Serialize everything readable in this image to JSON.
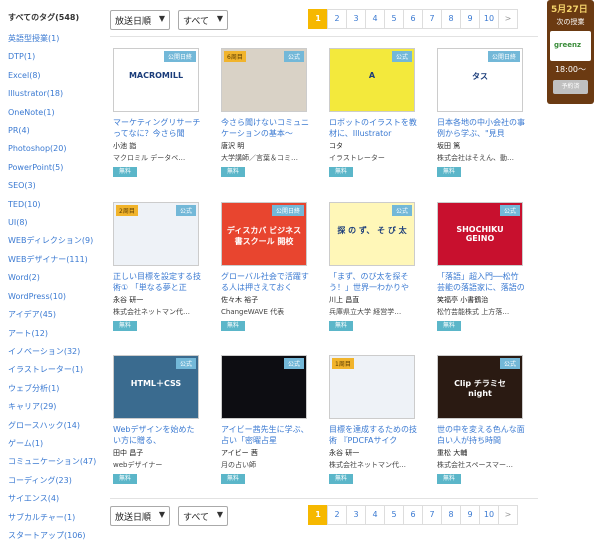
{
  "sidebar": {
    "heading": "すべてのタグ(548)",
    "tags": [
      "英語型授業(1)",
      "DTP(1)",
      "Excel(8)",
      "Illustrator(18)",
      "OneNote(1)",
      "PR(4)",
      "Photoshop(20)",
      "PowerPoint(5)",
      "SEO(3)",
      "TED(10)",
      "UI(8)",
      "WEBディレクション(9)",
      "WEBデザイナー(111)",
      "Word(2)",
      "WordPress(10)",
      "アイデア(45)",
      "アート(12)",
      "イノベーション(32)",
      "イラストレーター(1)",
      "ウェブ分析(1)",
      "キャリア(29)",
      "グロースハック(14)",
      "ゲーム(1)",
      "コミュニケーション(47)",
      "コーディング(23)",
      "サイエンス(4)",
      "サブカルチャー(1)",
      "スタートアップ(106)"
    ]
  },
  "controls": {
    "sort_label": "放送日順",
    "filter_label": "すべて",
    "pages": [
      "1",
      "2",
      "3",
      "4",
      "5",
      "6",
      "7",
      "8",
      "9",
      "10",
      ">"
    ],
    "current_page": "1"
  },
  "cards": [
    {
      "badge": "公開日終",
      "ribbon": "",
      "title": "マーケティングリサーチってなに？今さら聞",
      "name": "小池 詣",
      "desc": "マクロミル データベ…",
      "price": "無料",
      "thumb_text": "MACROMILL",
      "thumb_color": "#ffffff"
    },
    {
      "badge": "公式",
      "ribbon": "6周目",
      "title": "今さら聞けないコミュニケーションの基本〜",
      "name": "唐沢 明",
      "desc": "大学講師／言葉＆コミ…",
      "price": "無料",
      "thumb_text": "",
      "thumb_color": "#d9d2c6"
    },
    {
      "badge": "公式",
      "ribbon": "",
      "title": "ロボットのイラストを教材に、Illustrator",
      "name": "コタ",
      "desc": "イラストレーター",
      "price": "無料",
      "thumb_text": "A",
      "thumb_color": "#f3e93c"
    },
    {
      "badge": "公開日終",
      "ribbon": "",
      "title": "日本各地の中小会社の事例から学ぶ、\"見貝",
      "name": "坂田 篤",
      "desc": "株式会社はそえん、動…",
      "price": "無料",
      "thumb_text": "タス",
      "thumb_color": "#ffffff"
    },
    {
      "badge": "公式",
      "ribbon": "2周目",
      "title": "正しい目標を設定する技術① 「単なる夢と正",
      "name": "永谷 研一",
      "desc": "株式会社ネットマン代…",
      "price": "無料",
      "thumb_text": "",
      "thumb_color": "#eef2f7"
    },
    {
      "badge": "公開日終",
      "ribbon": "",
      "title": "グローバル社会で活躍する人は押さえておく",
      "name": "佐々木 裕子",
      "desc": "ChangeWAVE 代表",
      "price": "無料",
      "thumb_text": "ディスカバ ビジネス書スクール 開校",
      "thumb_color": "#e8452f"
    },
    {
      "badge": "公式",
      "ribbon": "",
      "title": "「まず、のび太を探そう！」世界一わかりや",
      "name": "川上 昌直",
      "desc": "兵庫県立大学 経営学…",
      "price": "無料",
      "thumb_text": "探 の ず、 そ び 太",
      "thumb_color": "#fff7b8"
    },
    {
      "badge": "公式",
      "ribbon": "",
      "title": "「落語」超入門──松竹芸能の落語家に、落語の",
      "name": "笑福亭 小書鶴治",
      "desc": "松竹芸能株式 上方落…",
      "price": "無料",
      "thumb_text": "SHOCHIKU GEINO",
      "thumb_color": "#c8102e"
    },
    {
      "badge": "公式",
      "ribbon": "",
      "title": "Webデザインを始めたい方に贈る、",
      "name": "田中 昌子",
      "desc": "webデザイナー",
      "price": "無料",
      "thumb_text": "HTML＋CSS",
      "thumb_color": "#3a6b8f"
    },
    {
      "badge": "公式",
      "ribbon": "",
      "title": "アイビー茜先生に学ぶ、占い「密曜占星",
      "name": "アイビー 茜",
      "desc": "月の占い師",
      "price": "無料",
      "thumb_text": "",
      "thumb_color": "#0d0d12"
    },
    {
      "badge": "",
      "ribbon": "1周目",
      "title": "目標を達成するための技術 『PDCFAサイク",
      "name": "永谷 研一",
      "desc": "株式会社ネットマン代…",
      "price": "無料",
      "thumb_text": "",
      "thumb_color": "#eef2f7"
    },
    {
      "badge": "公式",
      "ribbon": "",
      "title": "世の中を変える色んな面白い人が持ち時間",
      "name": "重松 大輔",
      "desc": "株式会社スペースマー…",
      "price": "無料",
      "thumb_text": "Clip チラミセ night",
      "thumb_color": "#2a1a12"
    }
  ],
  "widget": {
    "date": "5月27日",
    "label": "次の授業",
    "logo_text": "greenz",
    "time": "18:00〜",
    "button": "予約済"
  },
  "colors": {
    "accent": "#f6b800",
    "link": "#3b7ad2",
    "price_badge": "#5bb6c9",
    "widget_bg": "#6b3a12"
  }
}
